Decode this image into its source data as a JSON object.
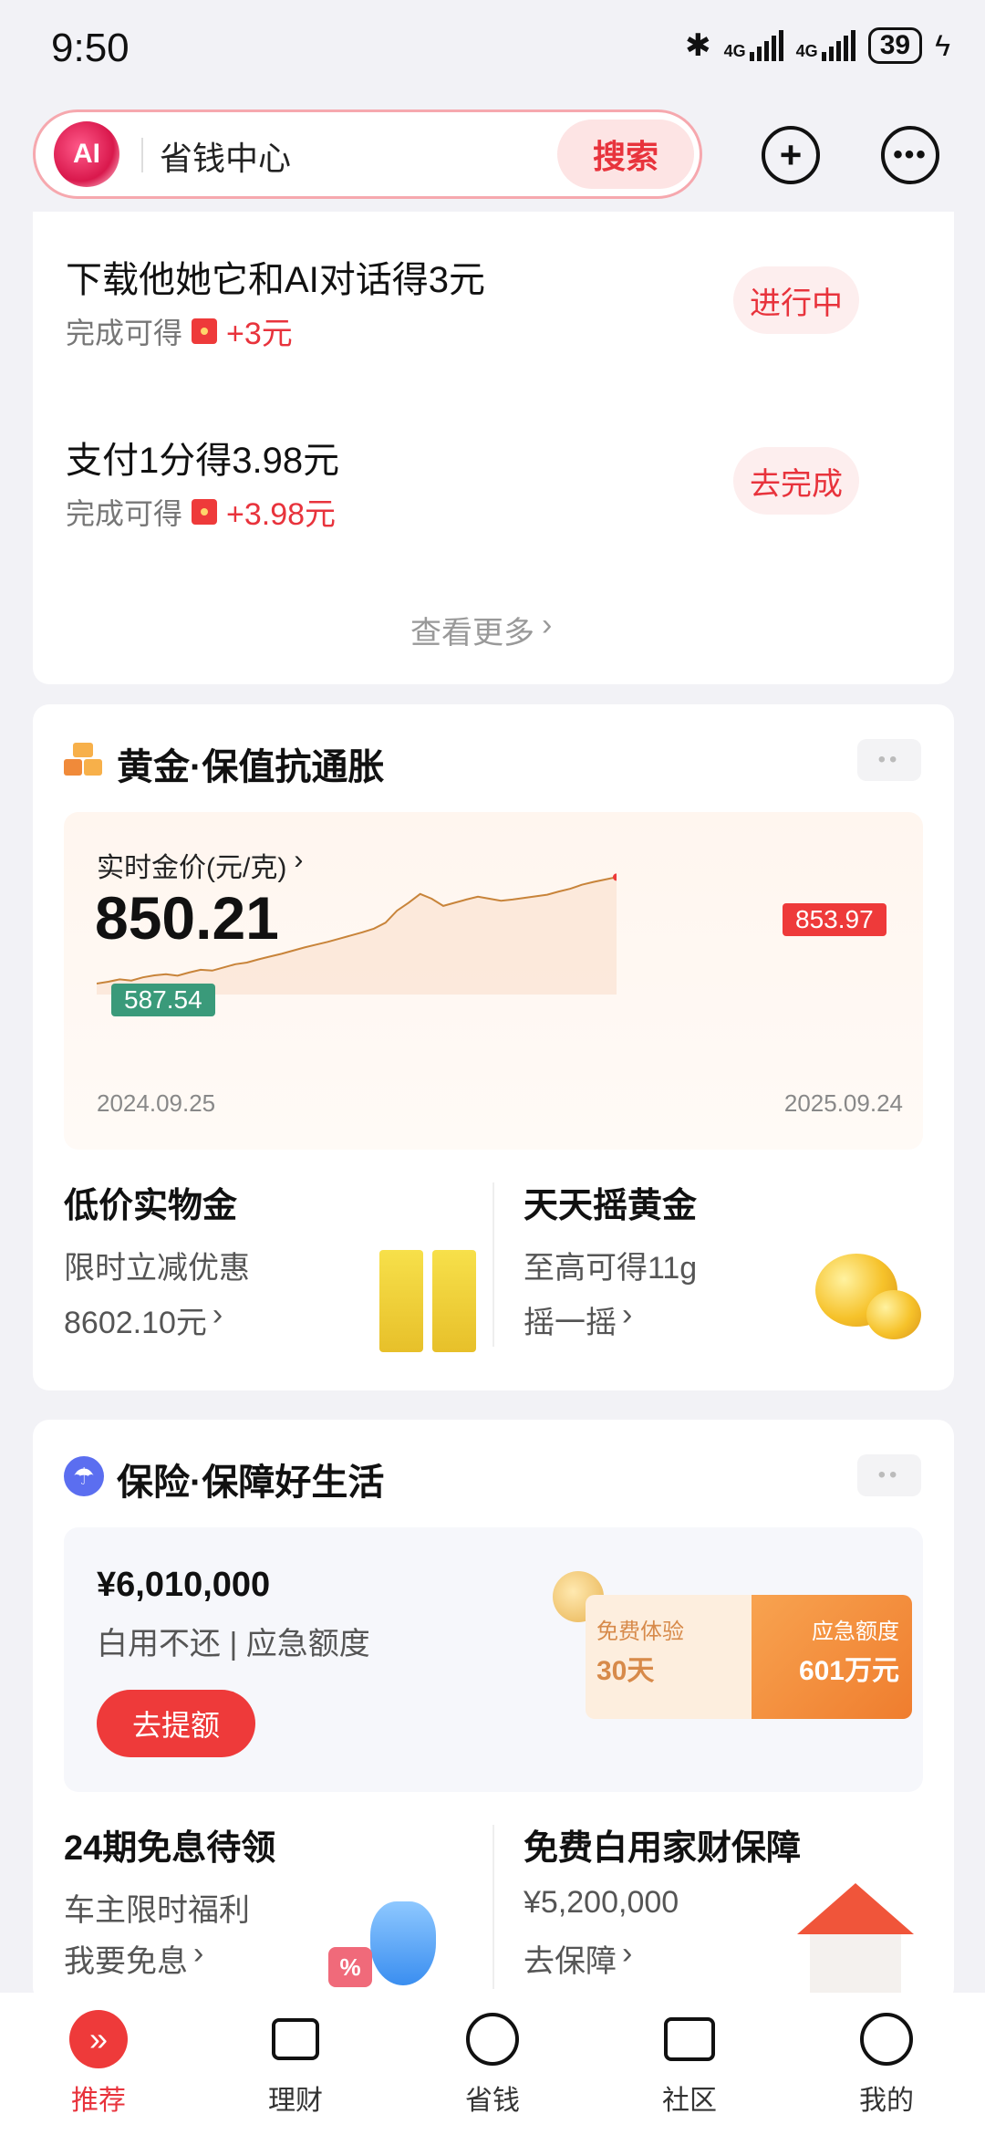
{
  "status_bar": {
    "time": "9:50",
    "network1": "4G",
    "network2": "4G",
    "battery": "39"
  },
  "header": {
    "ai_badge": "AI",
    "search_text": "省钱中心",
    "search_button": "搜索"
  },
  "tasks": {
    "items": [
      {
        "title": "下载他她它和AI对话得3元",
        "prefix": "完成可得",
        "reward": "+3元",
        "action": "进行中"
      },
      {
        "title": "支付1分得3.98元",
        "prefix": "完成可得",
        "reward": "+3.98元",
        "action": "去完成"
      }
    ],
    "more": "查看更多"
  },
  "gold": {
    "title": "黄金·保值抗通胀",
    "price_label": "实时金价(元/克)",
    "price": "850.21",
    "start_date": "2024.09.25",
    "end_date": "2025.09.24",
    "low_label": "587.54",
    "high_label": "853.97",
    "promo_left": {
      "title": "低价实物金",
      "line1": "限时立减优惠",
      "line2": "8602.10元"
    },
    "promo_right": {
      "title": "天天摇黄金",
      "line1": "至高可得11g",
      "line2": "摇一摇"
    }
  },
  "insurance": {
    "title": "保险·保障好生活",
    "amount": "¥6,010,000",
    "desc": "白用不还 | 应急额度",
    "button": "去提额",
    "badge_left_1": "免费体验",
    "badge_left_2": "30天",
    "badge_right_1": "应急额度",
    "badge_right_2": "601万元",
    "promo_left": {
      "title": "24期免息待领",
      "line1": "车主限时福利",
      "line2": "我要免息"
    },
    "promo_right": {
      "title": "免费白用家财保障",
      "line1": "¥5,200,000",
      "line2": "去保障"
    }
  },
  "tabbar": [
    {
      "label": "推荐"
    },
    {
      "label": "理财"
    },
    {
      "label": "省钱"
    },
    {
      "label": "社区"
    },
    {
      "label": "我的"
    }
  ],
  "colors": {
    "accent": "#e8333c",
    "gold_line": "#c8843a",
    "low_tag": "#3a9a7a"
  },
  "chart_data": {
    "type": "area",
    "x_start": "2024.09.25",
    "x_end": "2025.09.24",
    "values": [
      587.54,
      592,
      598,
      595,
      603,
      608,
      611,
      607,
      615,
      622,
      620,
      628,
      636,
      640,
      648,
      655,
      662,
      670,
      678,
      685,
      692,
      700,
      708,
      716,
      725,
      740,
      770,
      790,
      812,
      800,
      782,
      790,
      798,
      805,
      800,
      795,
      798,
      802,
      806,
      810,
      818,
      825,
      835,
      842,
      848,
      853.97
    ],
    "low": 587.54,
    "high": 853.97,
    "current": 850.21
  }
}
